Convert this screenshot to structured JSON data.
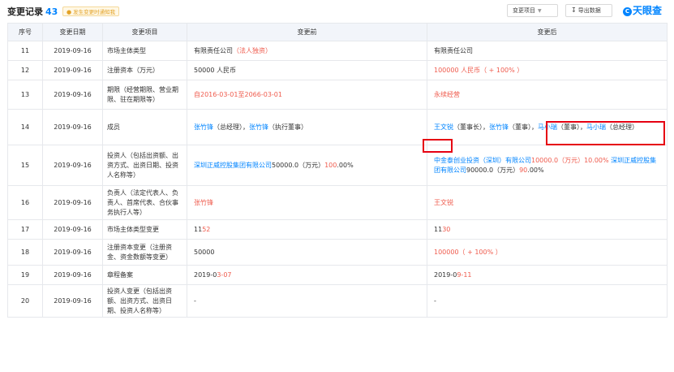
{
  "header": {
    "title": "变更记录",
    "count": "43",
    "notify_label": "发生变更时通知我",
    "change_type_button": "变更项目",
    "export_button": "导出数据",
    "logo_mark": "C",
    "logo_text": "天眼查"
  },
  "columns": [
    "序号",
    "变更日期",
    "变更项目",
    "变更前",
    "变更后"
  ],
  "rows": [
    {
      "no": "11",
      "date": "2019-09-16",
      "item": "市场主体类型",
      "before": [
        [
          "有限责任公司",
          ""
        ],
        [
          "（法人独资）",
          "red"
        ]
      ],
      "after": [
        [
          "有限责任公司",
          ""
        ]
      ]
    },
    {
      "no": "12",
      "date": "2019-09-16",
      "item": "注册资本（万元）",
      "before": [
        [
          "50000 人民币",
          ""
        ]
      ],
      "after": [
        [
          "100000 人民币（ + 100% ）",
          "red"
        ]
      ]
    },
    {
      "no": "13",
      "date": "2019-09-16",
      "item": "期限（经营期限、营业期限、驻在期限等）",
      "before": [
        [
          "自2016-03-01至2066-03-01",
          "red"
        ]
      ],
      "after": [
        [
          "永续经营",
          "red"
        ]
      ]
    },
    {
      "no": "14",
      "date": "2019-09-16",
      "item": "成员",
      "before": [
        [
          "张竹锋",
          "blue"
        ],
        [
          "（总经理），",
          ""
        ],
        [
          "张竹锋",
          "blue"
        ],
        [
          "（执行董事）",
          ""
        ]
      ],
      "after": [
        [
          "王文锐",
          "blue"
        ],
        [
          "（董事长），",
          ""
        ],
        [
          "张竹锋",
          "blue"
        ],
        [
          "（董事），",
          ""
        ],
        [
          "马小瑞",
          "blue"
        ],
        [
          "（董事），",
          ""
        ],
        [
          "马小瑞",
          "blue"
        ],
        [
          "（总经理）",
          ""
        ]
      ]
    },
    {
      "no": "15",
      "date": "2019-09-16",
      "item": "投资人（包括出资额、出资方式、出资日期、投资人名称等）",
      "before": [
        [
          "深圳正威控股集团有限公司",
          "blue"
        ],
        [
          "50000.0（万元）",
          ""
        ],
        [
          "100",
          "red"
        ],
        [
          ".00%",
          ""
        ]
      ],
      "after": [
        [
          "中金泰创业投资（深圳）有限公司",
          "blue"
        ],
        [
          "10000.0（万元）",
          "red"
        ],
        [
          "10.00%",
          "red"
        ],
        [
          " 深圳正威控股集团有限公司",
          "blue"
        ],
        [
          "90000.0（万元）",
          ""
        ],
        [
          "90",
          "red"
        ],
        [
          ".00%",
          ""
        ]
      ]
    },
    {
      "no": "16",
      "date": "2019-09-16",
      "item": "负责人（法定代表人、负责人、首席代表、合伙事务执行人等）",
      "before": [
        [
          "张竹锋",
          "red"
        ]
      ],
      "after": [
        [
          "王文锐",
          "red"
        ]
      ]
    },
    {
      "no": "17",
      "date": "2019-09-16",
      "item": "市场主体类型变更",
      "before": [
        [
          "11",
          ""
        ],
        [
          "52",
          "red"
        ]
      ],
      "after": [
        [
          "11",
          ""
        ],
        [
          "30",
          "red"
        ]
      ]
    },
    {
      "no": "18",
      "date": "2019-09-16",
      "item": "注册资本变更（注册资金、资金数额等变更）",
      "before": [
        [
          "50000",
          ""
        ]
      ],
      "after": [
        [
          "100000（ + 100% ）",
          "red"
        ]
      ]
    },
    {
      "no": "19",
      "date": "2019-09-16",
      "item": "章程备案",
      "before": [
        [
          "2019-0",
          ""
        ],
        [
          "3-07",
          "red"
        ]
      ],
      "after": [
        [
          "2019-0",
          ""
        ],
        [
          "9-11",
          "red"
        ]
      ]
    },
    {
      "no": "20",
      "date": "2019-09-16",
      "item": "投资人变更（包括出资额、出资方式、出资日期、投资人名称等）",
      "before": [
        [
          "-",
          ""
        ]
      ],
      "after": [
        [
          "-",
          ""
        ]
      ]
    }
  ]
}
